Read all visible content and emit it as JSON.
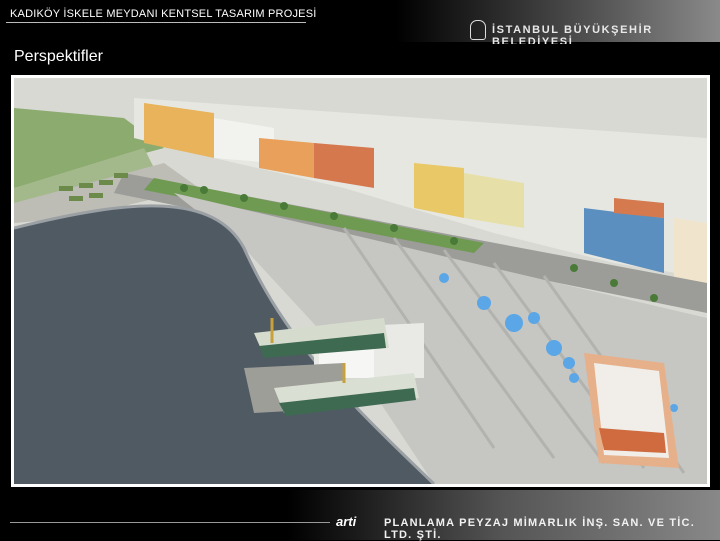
{
  "header": {
    "project_title": "KADIKÖY İSKELE MEYDANI KENTSEL TASARIM PROJESİ",
    "municipality": "İSTANBUL BÜYÜKŞEHİR BELEDİYESİ",
    "logo_icon": "ibb-emblem-icon"
  },
  "section": {
    "title": "Perspektifler"
  },
  "image": {
    "subject": "aerial-rendering"
  },
  "footer": {
    "firm_logo": "arti",
    "firm_name": "PLANLAMA PEYZAJ MİMARLIK İNŞ. SAN. VE TİC. LTD. ŞTİ."
  },
  "colors": {
    "background": "#000000",
    "frame": "#ffffff",
    "water": "#4f5a63",
    "accent_green": "#3ea047"
  }
}
